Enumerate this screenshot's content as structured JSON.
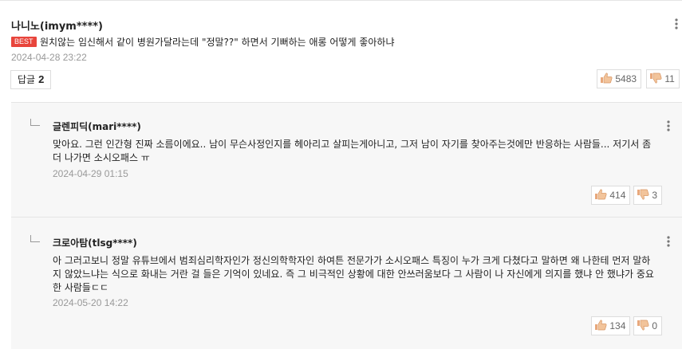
{
  "comment": {
    "author": "나니노(imym****)",
    "best_badge": "BEST",
    "body": "원치않는 임신해서 같이 병원가달라는데 \"정말??\" 하면서 기뻐하는 애롱 어떻게 좋아하냐",
    "timestamp": "2024-04-28 23:22",
    "reply_label": "답글",
    "reply_count": "2",
    "likes": "5483",
    "dislikes": "11"
  },
  "replies": [
    {
      "author": "글렌피딕(mari****)",
      "body": "맞아요. 그런 인간형 진짜 소름이에요.. 남이 무슨사정인지를 헤아리고 살피는게아니고, 그저 남이 자기를 찾아주는것에만 반응하는 사람들... 저기서 좀 더 나가면 소시오패스 ㅠ",
      "timestamp": "2024-04-29 01:15",
      "likes": "414",
      "dislikes": "3"
    },
    {
      "author": "크로아탐(tlsg****)",
      "body": "아 그러고보니 정말 유튜브에서 범죄심리학자인가 정신의학학자인 하여튼 전문가가 소시오패스 특징이 누가 크게 다쳤다고 말하면 왜 나한테 먼저 말하지 않았느냐는 식으로 화내는 거란 걸 들은 기억이 있네요. 즉 그 비극적인 상황에 대한 안쓰러움보다 그 사람이 나 자신에게 의지를 했냐 안 했냐가 중요한 사람들ㄷㄷ",
      "timestamp": "2024-05-20 14:22",
      "likes": "134",
      "dislikes": "0"
    }
  ],
  "icons": {
    "more": "kebab-icon",
    "like": "thumbs-up-icon",
    "dislike": "thumbs-down-icon"
  },
  "colors": {
    "best_badge": "#e8453c",
    "like_icon": "#e8a87c",
    "muted_text": "#999999",
    "reply_background": "#f7f7f7"
  }
}
